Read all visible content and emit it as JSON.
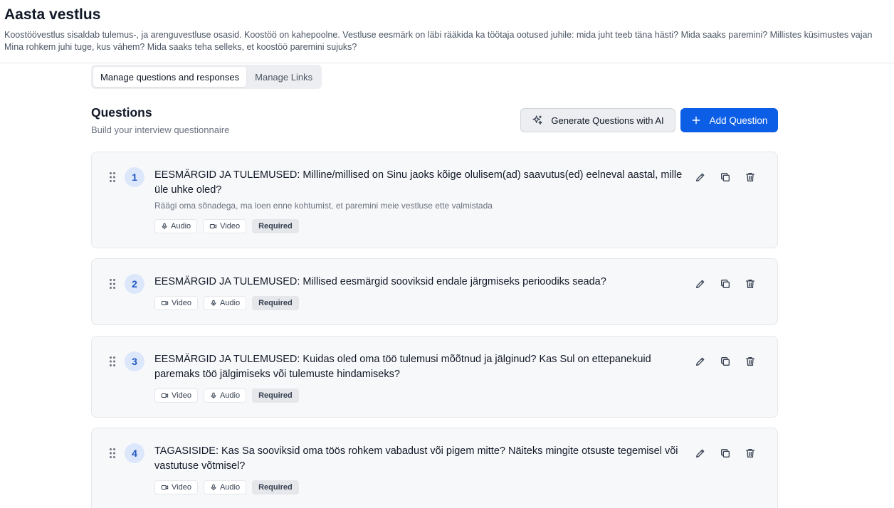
{
  "header": {
    "title": "Aasta vestlus",
    "description": "Koostöövestlus sisaldab tulemus-, ja arenguvestluse osasid. Koostöö on kahepoolne. Vestluse eesmärk on läbi rääkida ka töötaja ootused juhile: mida juht teeb täna hästi? Mida saaks paremini? Millistes küsimustes vajan Mina rohkem juhi tuge, kus vähem? Mida saaks teha selleks, et koostöö paremini sujuks?"
  },
  "tabs": [
    {
      "label": "Manage questions and responses",
      "active": true
    },
    {
      "label": "Manage Links",
      "active": false
    }
  ],
  "questions_section": {
    "title": "Questions",
    "subtitle": "Build your interview questionnaire",
    "generate_label": "Generate Questions with AI",
    "add_label": "Add Question"
  },
  "questions": [
    {
      "number": "1",
      "text": "EESMÄRGID JA TULEMUSED: Milline/millised on Sinu jaoks kõige olulisem(ad) saavutus(ed) eelneval aastal, mille üle uhke oled?",
      "hint": "Räägi oma sõnadega, ma loen enne kohtumist, et paremini meie vestluse ette valmistada",
      "badges": [
        "Audio",
        "Video",
        "Required"
      ]
    },
    {
      "number": "2",
      "text": "EESMÄRGID JA TULEMUSED: Millised eesmärgid sooviksid endale järgmiseks perioodiks seada?",
      "hint": "",
      "badges": [
        "Video",
        "Audio",
        "Required"
      ]
    },
    {
      "number": "3",
      "text": "EESMÄRGID JA TULEMUSED: Kuidas oled oma töö tulemusi mõõtnud ja jälginud? Kas Sul on ettepanekuid paremaks töö jälgimiseks või tulemuste hindamiseks?",
      "hint": "",
      "badges": [
        "Video",
        "Audio",
        "Required"
      ]
    },
    {
      "number": "4",
      "text": "TAGASISIDE: Kas Sa sooviksid oma töös rohkem vabadust või pigem mitte? Näiteks mingite otsuste tegemisel või vastutuse võtmisel?",
      "hint": "",
      "badges": [
        "Video",
        "Audio",
        "Required"
      ]
    }
  ],
  "icons": {
    "drag": "drag-handle-icon",
    "audio": "microphone-icon",
    "video": "video-camera-icon",
    "edit": "pencil-icon",
    "copy": "copy-icon",
    "delete": "trash-icon",
    "ai": "sparkles-icon",
    "add": "plus-icon"
  },
  "colors": {
    "primary": "#0d5ee6",
    "number_bg": "#dde7fb",
    "number_fg": "#1f57c3",
    "card_bg": "#f7f8fa"
  }
}
